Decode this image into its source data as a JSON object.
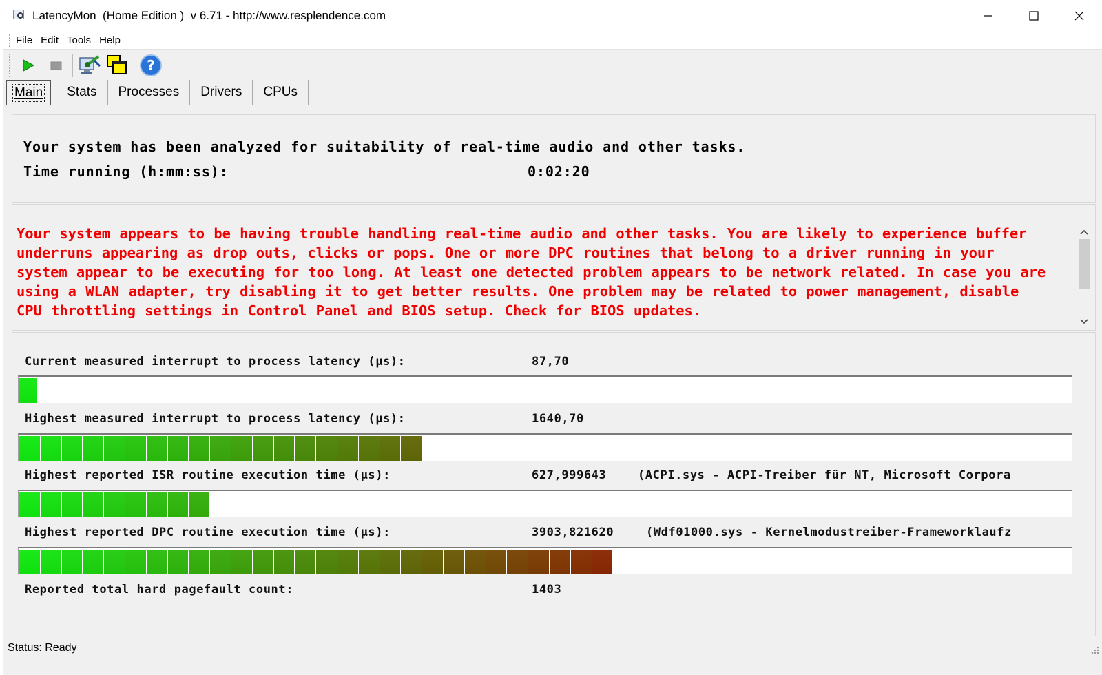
{
  "window": {
    "title": "LatencyMon  (Home Edition )  v 6.71 - http://www.resplendence.com"
  },
  "menu": [
    {
      "label": "File",
      "name": "menu-file"
    },
    {
      "label": "Edit",
      "name": "menu-edit"
    },
    {
      "label": "Tools",
      "name": "menu-tools"
    },
    {
      "label": "Help",
      "name": "menu-help"
    }
  ],
  "toolbar": {
    "icons": [
      "play-icon",
      "stop-icon",
      "analyze-icon",
      "window-icon",
      "help-icon"
    ]
  },
  "tabs": [
    {
      "label": "Main",
      "active": true
    },
    {
      "label": "Stats"
    },
    {
      "label": "Processes"
    },
    {
      "label": "Drivers"
    },
    {
      "label": "CPUs"
    }
  ],
  "summary": {
    "line1": "Your system has been analyzed for suitability of real-time audio and other tasks.",
    "time_label": "Time running (h:mm:ss):",
    "time_value": "0:02:20"
  },
  "conclusion": {
    "text": "Your system appears to be having trouble handling real-time audio and other tasks. You are likely to experience buffer underruns appearing as drop outs, clicks or pops. One or more DPC routines that belong to a driver running in your system appear to be executing for too long. At least one detected problem appears to be network related. In case you are using a WLAN adapter, try disabling it to get better results. One problem may be related to power management, disable CPU throttling settings in Control Panel and BIOS setup. Check for BIOS updates."
  },
  "metrics": {
    "current_latency": {
      "label": "Current measured interrupt to process latency (µs):",
      "value": "87,70",
      "level_fraction": 0.017
    },
    "highest_latency": {
      "label": "Highest measured interrupt to process latency (µs):",
      "value": "1640,70",
      "level_fraction": 0.385
    },
    "highest_isr": {
      "label": "Highest reported ISR routine execution time (µs):",
      "value": "627,999643",
      "detail": "(ACPI.sys - ACPI-Treiber für NT, Microsoft Corpora",
      "level_fraction": 0.181
    },
    "highest_dpc": {
      "label": "Highest reported DPC routine execution time (µs):",
      "value": "3903,821620",
      "detail": "(Wdf01000.sys - Kernelmodustreiber-Frameworklaufz",
      "level_fraction": 0.566
    },
    "pagefault": {
      "label": "Reported total hard pagefault count:",
      "value": "1403"
    }
  },
  "status": {
    "text": "Status: Ready"
  },
  "colors": {
    "warning": "#f00000",
    "bar_green": "#10e010",
    "bar_red": "#8a1c00"
  }
}
